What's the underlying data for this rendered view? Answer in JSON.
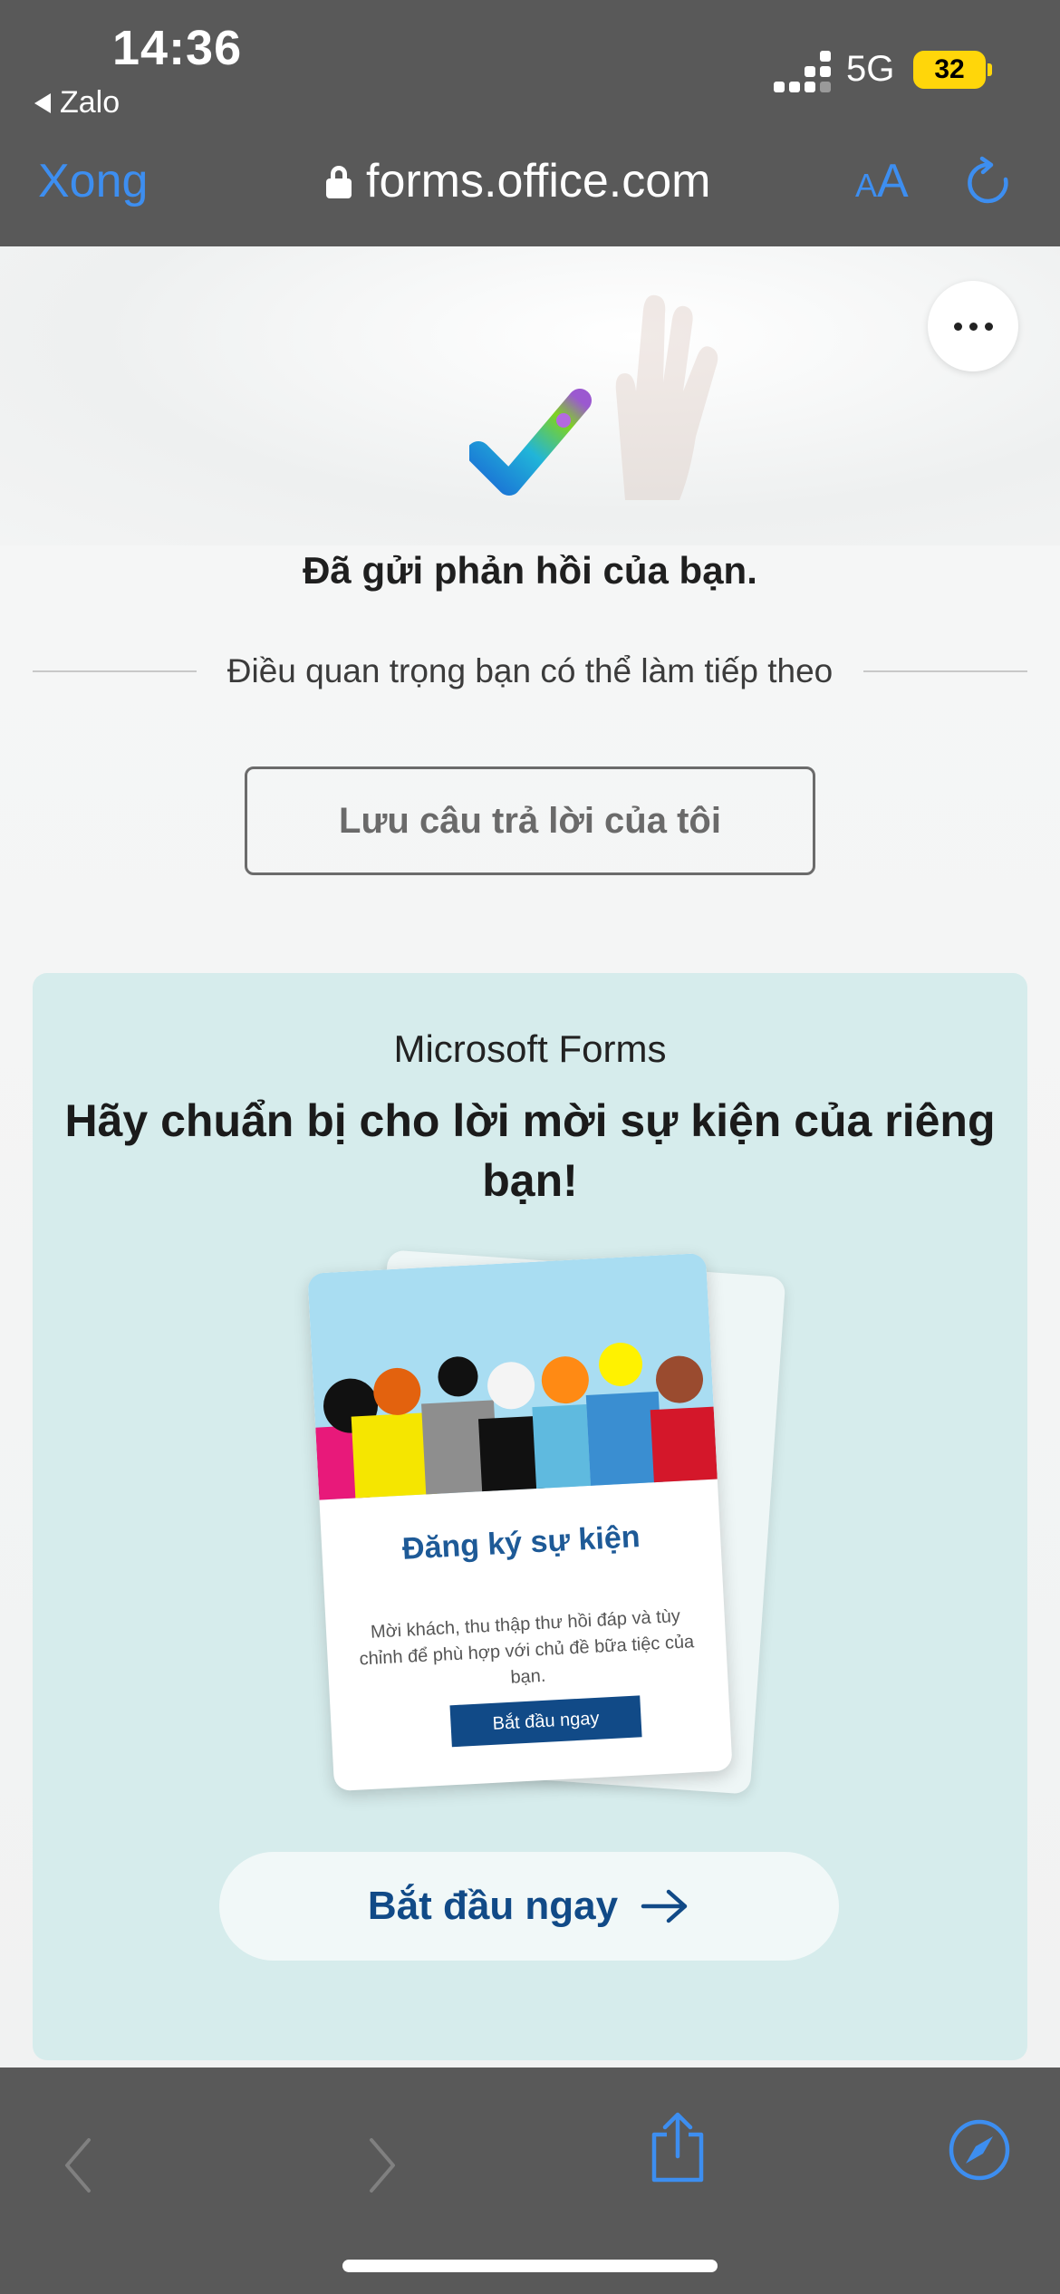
{
  "status_bar": {
    "time": "14:36",
    "back_app": "Zalo",
    "network": "5G",
    "battery": "32"
  },
  "nav": {
    "done_label": "Xong",
    "url": "forms.office.com",
    "text_size_label_small": "A",
    "text_size_label_large": "A",
    "icons": [
      "lock-icon",
      "text-size-icon",
      "reload-icon"
    ]
  },
  "page": {
    "menu_icon": "more-icon",
    "submitted_title": "Đã gửi phản hồi của bạn.",
    "next_steps_label": "Điều quan trọng bạn có thể làm tiếp theo",
    "save_button": "Lưu câu trả lời của tôi",
    "promo": {
      "brand": "Microsoft Forms",
      "title": "Hãy chuẩn bị cho lời mời sự kiện của riêng bạn!",
      "card_title": "Đăng ký sự kiện",
      "card_description": "Mời khách, thu thập thư hồi đáp và tùy chỉnh để phù hợp với chủ đề bữa tiệc của bạn.",
      "card_button": "Bắt đầu ngay",
      "start_button": "Bắt đầu ngay"
    }
  },
  "toolbar": {
    "icons": [
      "back-icon",
      "forward-icon",
      "share-icon",
      "compass-icon"
    ],
    "accent": "#3d8ef0",
    "disabled": "#808080"
  }
}
